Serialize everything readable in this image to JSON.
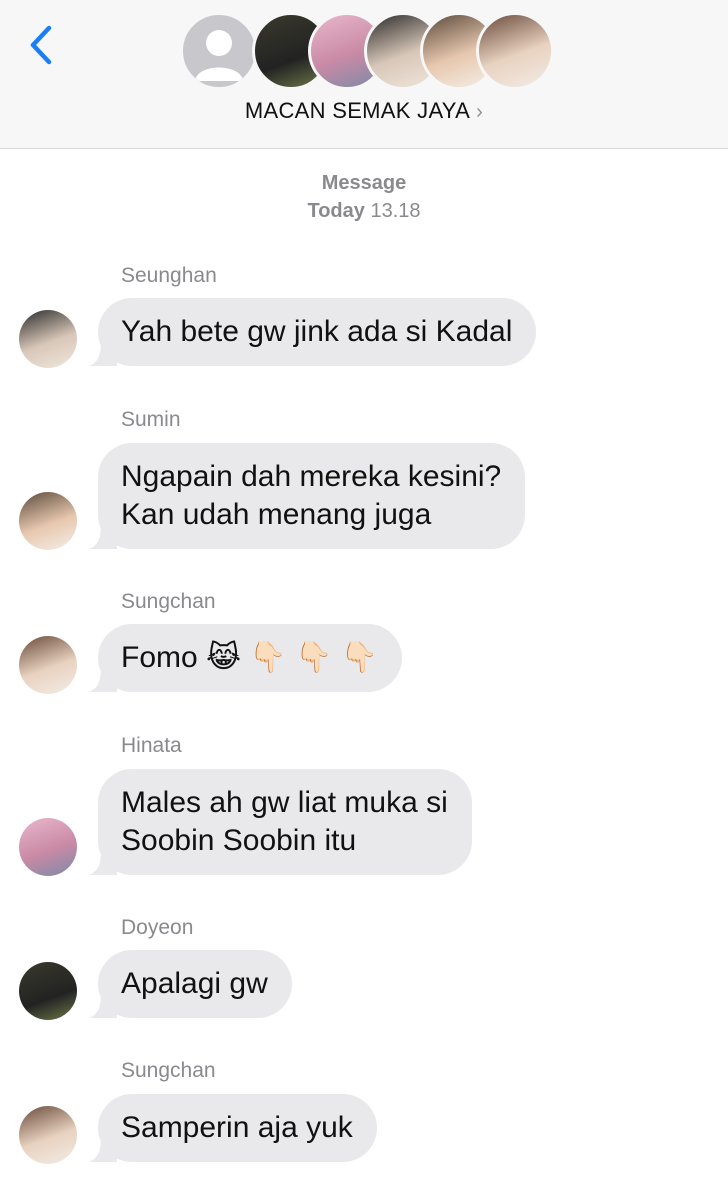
{
  "header": {
    "group_name": "MACAN SEMAK JAYA",
    "chevron": "›",
    "back_icon": "chevron-left-icon"
  },
  "timestamp": {
    "label": "Message",
    "day": "Today",
    "time": "13.18"
  },
  "messages": [
    {
      "sender": "Seunghan",
      "lines": [
        "Yah bete gw jink ada si Kadal"
      ]
    },
    {
      "sender": "Sumin",
      "lines": [
        "Ngapain dah mereka kesini?",
        "Kan udah menang juga"
      ]
    },
    {
      "sender": "Sungchan",
      "lines": [
        "Fomo 😹 👇🏻 👇🏻 👇🏻"
      ]
    },
    {
      "sender": "Hinata",
      "lines": [
        "Males ah gw liat muka si",
        "Soobin Soobin itu"
      ]
    },
    {
      "sender": "Doyeon",
      "lines": [
        "Apalagi gw"
      ]
    },
    {
      "sender": "Sungchan",
      "lines": [
        "Samperin aja yuk"
      ]
    }
  ],
  "colors": {
    "accent": "#1a7ef7",
    "bubble": "#e9e9eb",
    "meta_text": "#8a8a8e"
  }
}
